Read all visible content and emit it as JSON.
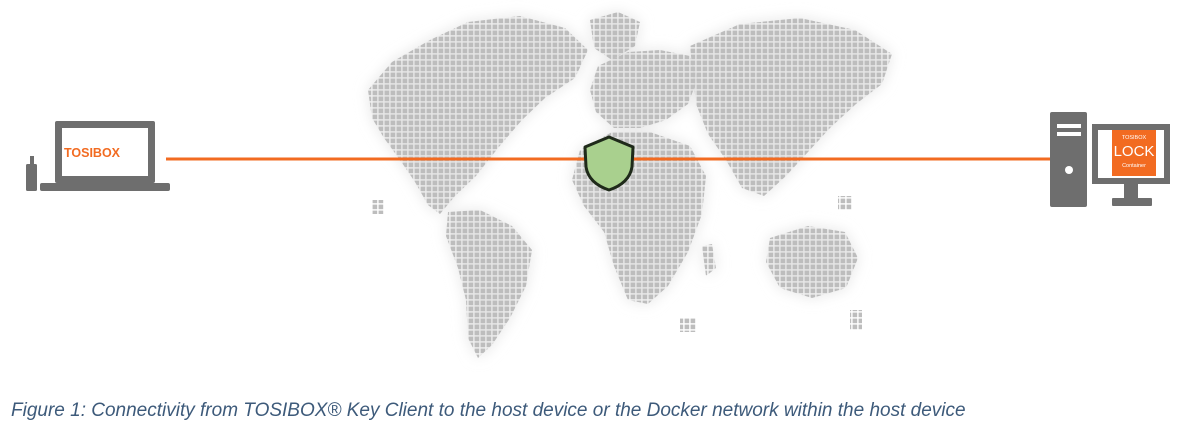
{
  "figure": {
    "laptop_screen_label": "TOSIBOX",
    "lock_label_top": "TOSIBOX",
    "lock_label_main": "LOCK",
    "lock_label_sub": "Container",
    "caption": "Figure 1: Connectivity from TOSIBOX® Key Client to the host device or the Docker network within the host device"
  },
  "colors": {
    "accent": "#f26b21",
    "device_gray": "#6e6e6e",
    "map_dot": "#bdbdbd",
    "map_halo": "#ececec",
    "shield_fill": "#a9d08e",
    "shield_stroke": "#1f2a1a",
    "caption": "#3d5a7a"
  },
  "icons": [
    "laptop-icon",
    "usb-key-icon",
    "world-map",
    "shield-icon",
    "desktop-tower-icon",
    "monitor-icon"
  ]
}
